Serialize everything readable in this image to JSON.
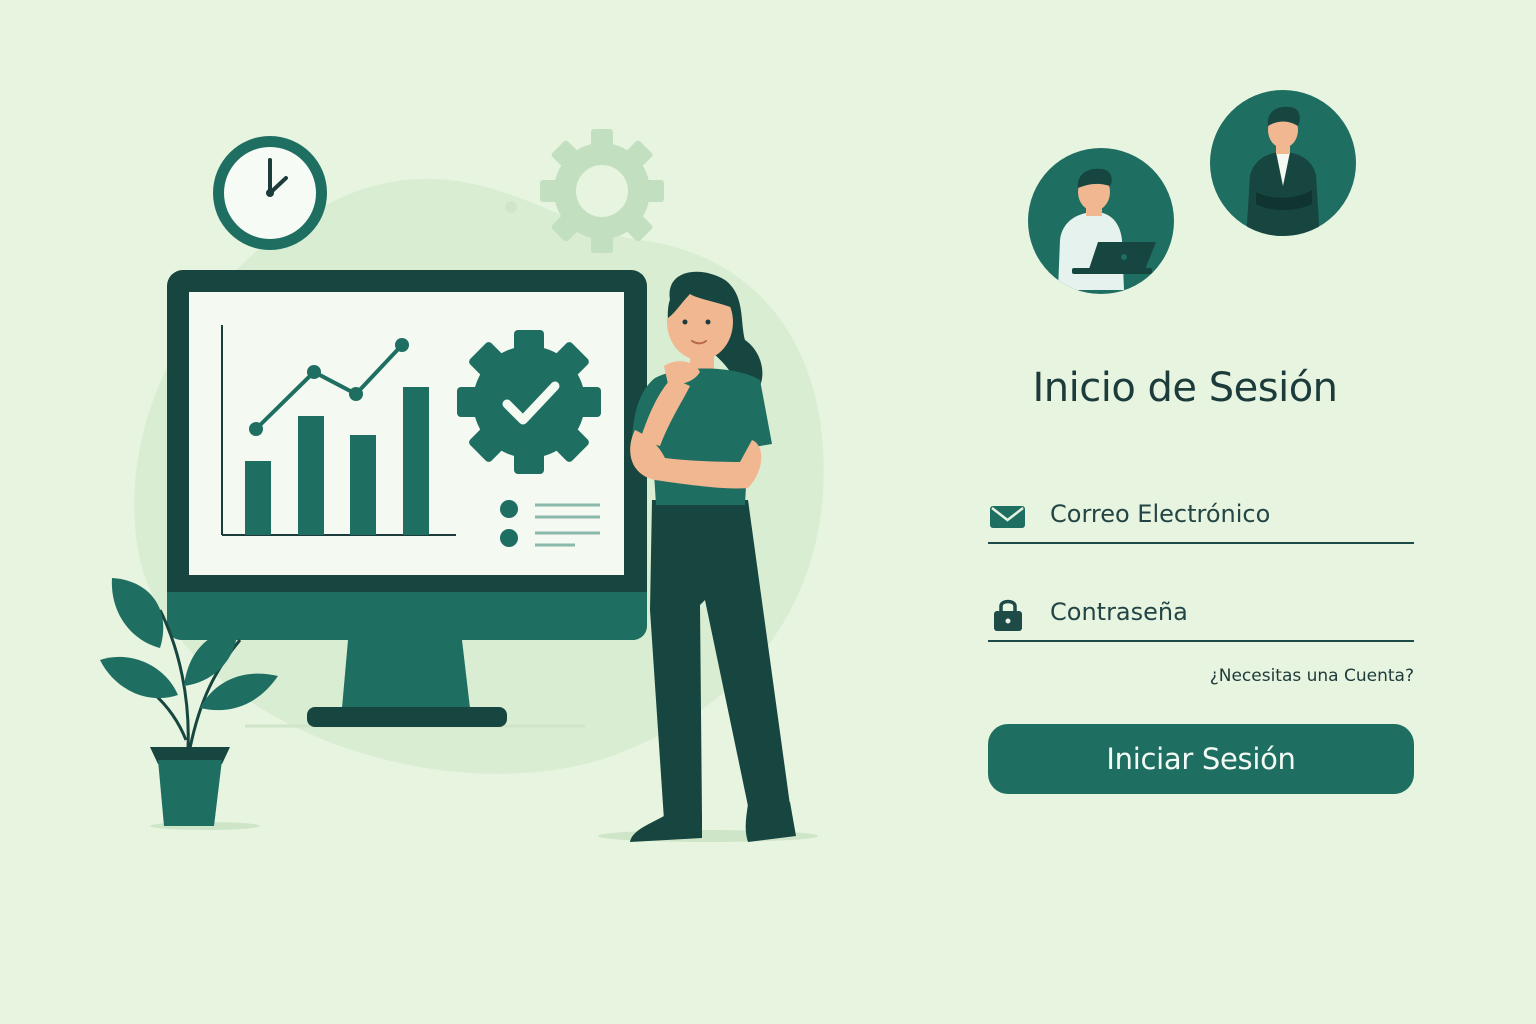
{
  "login": {
    "title": "Inicio de Sesión",
    "email": {
      "placeholder": "Correo Electrónico",
      "value": "",
      "icon": "envelope-icon"
    },
    "password": {
      "placeholder": "Contraseña",
      "value": "",
      "icon": "lock-icon"
    },
    "signup_link": "¿Necesitas una Cuenta?",
    "submit_label": "Iniciar Sesión"
  },
  "illustration": {
    "icons": [
      "clock-icon",
      "gear-icon",
      "line-bar-chart",
      "gear-check-icon",
      "plant-icon",
      "woman-figure",
      "avatar-man-laptop",
      "avatar-man-suit"
    ]
  },
  "colors": {
    "background": "#e6f4e0",
    "primary": "#1f6e62",
    "dark": "#17453f",
    "text": "#1c3b3b",
    "screen": "#f4f9f1"
  }
}
